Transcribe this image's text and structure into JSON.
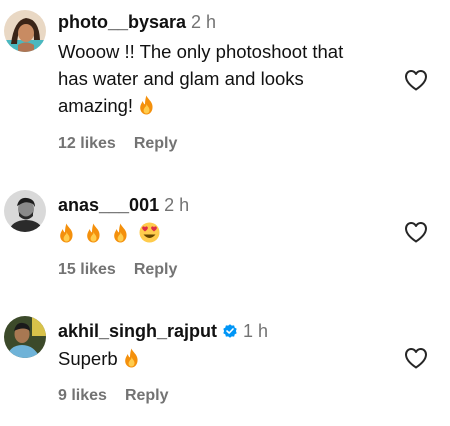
{
  "comments": [
    {
      "username": "photo__bysara",
      "time": "2 h",
      "text": "Wooow !! The only photoshoot that has water and glam and looks amazing!",
      "likes": "12 likes",
      "reply": "Reply",
      "verified": false
    },
    {
      "username": "anas___001",
      "time": "2 h",
      "text": "",
      "likes": "15 likes",
      "reply": "Reply",
      "verified": false
    },
    {
      "username": "akhil_singh_rajput",
      "time": "1 h",
      "text": "Superb",
      "likes": "9 likes",
      "reply": "Reply",
      "verified": true
    }
  ],
  "icons": {
    "like": "heart-outline-icon",
    "emoji_fire": "fire-emoji",
    "emoji_heart_eyes": "heart-eyes-emoji",
    "verified": "verified-badge-icon"
  },
  "colors": {
    "text": "#111111",
    "muted": "#737373",
    "verified": "#0095f6",
    "fire": "#f4900c"
  }
}
